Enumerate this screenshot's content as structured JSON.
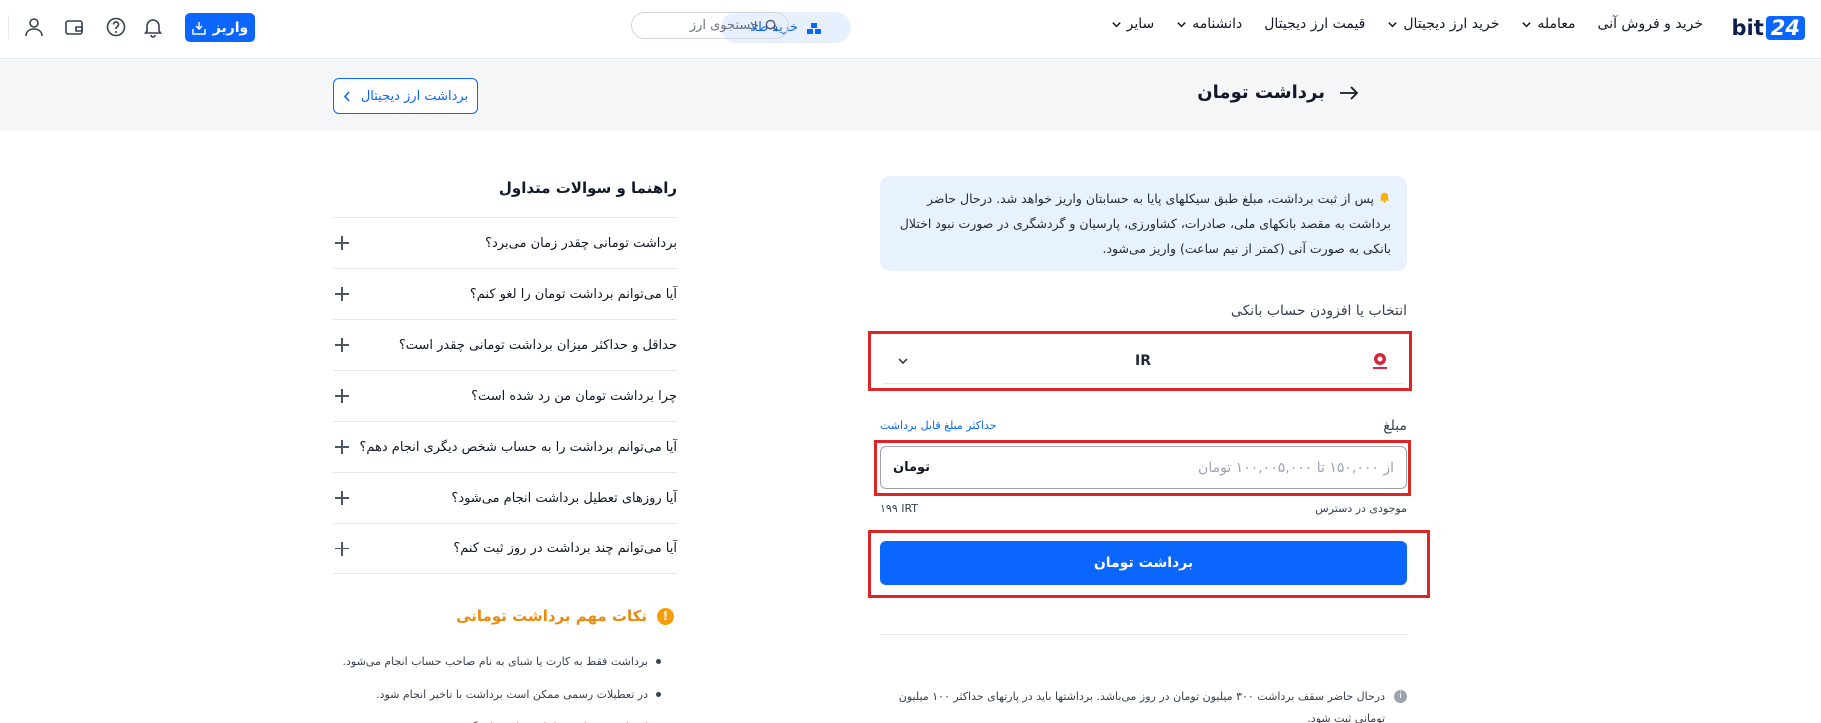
{
  "header": {
    "logo": {
      "word": "bit",
      "number": "24"
    },
    "nav": [
      {
        "label": "خرید و فروش آنی",
        "has_menu": false
      },
      {
        "label": "معامله",
        "has_menu": true
      },
      {
        "label": "خرید ارز دیجیتال",
        "has_menu": true
      },
      {
        "label": "قیمت ارز دیجیتال",
        "has_menu": false
      },
      {
        "label": "دانشنامه",
        "has_menu": true
      },
      {
        "label": "سایر",
        "has_menu": true
      }
    ],
    "gold_button": "خرید طلا",
    "search_placeholder": "جستجوی ارز",
    "deposit_button": "واریز"
  },
  "page": {
    "title": "برداشت تومان",
    "crypto_withdraw_button": "برداشت ارز دیجیتال"
  },
  "form": {
    "notice": "پس از ثبت برداشت، مبلغ طبق سیکلهای پایا به حسابتان واریز خواهد شد. درحال حاضر برداشت به مقصد بانکهای ملی، صادرات، کشاورزی، پارسیان و گردشگری در صورت نبود اختلال بانکی به صورت آنی (کمتر از نیم ساعت) واریز می‌شود.",
    "bank_section_label": "انتخاب یا افزودن حساب بانکی",
    "selected_bank": "IR",
    "amount_label": "مبلغ",
    "max_amount_link": "حداکثر مبلغ قابل برداشت",
    "amount_placeholder": "از ۱۵۰,۰۰۰ تا ۱۰۰,۰۰۵,۰۰۰ تومان",
    "amount_value": "",
    "amount_unit": "تومان",
    "balance_label": "موجودی در دسترس",
    "balance_value": "۱۹۹ IRT",
    "submit_button": "برداشت تومان",
    "footnote": "درحال حاضر سقف برداشت ۳۰۰ میلیون تومان در روز می‌باشد. برداشتها باید در پارتهای حداکثر ۱۰۰ میلیون تومانی ثبت شود."
  },
  "faq": {
    "title": "راهنما و سوالات متداول",
    "items": [
      "برداشت تومانی چقدر زمان می‌برد؟",
      "آیا می‌توانم برداشت تومان را لغو کنم؟",
      "حداقل و حداکثر میزان برداشت تومانی چقدر است؟",
      "چرا برداشت تومان من رد شده است؟",
      "آیا می‌توانم برداشت را به حساب شخص دیگری انجام دهم؟",
      "آیا روزهای تعطیل برداشت انجام می‌شود؟",
      "آیا می‌توانم چند برداشت در روز ثبت کنم؟"
    ]
  },
  "tips": {
    "title": "نکات مهم برداشت تومانی",
    "items": [
      "برداشت فقط به کارت یا شبای به نام صاحب حساب انجام می‌شود.",
      "در تعطیلات رسمی ممکن است برداشت با تاخیر انجام شود.",
      "اشتباه در شماره شبا باعث تاخیر یا برگشت وجه می‌شود."
    ]
  },
  "colors": {
    "accent": "#0a66ff",
    "highlight": "#dc2626",
    "notice_bg": "#e8f1fe",
    "tip": "#ea8a0c"
  }
}
